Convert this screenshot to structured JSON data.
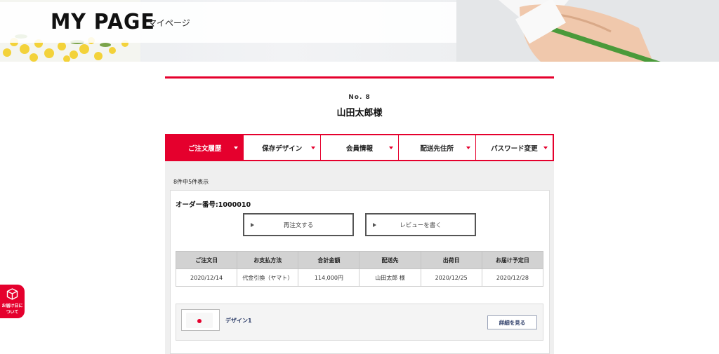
{
  "header": {
    "title": "MY PAGE",
    "subtitle": "マイページ",
    "decor_icons": [
      "yellow-flowers",
      "hand-writing-with-pen"
    ]
  },
  "member": {
    "number": "No. 8",
    "name": "山田太郎様"
  },
  "tabs": [
    {
      "label": "ご注文履歴",
      "active": true
    },
    {
      "label": "保存デザイン",
      "active": false
    },
    {
      "label": "会員情報",
      "active": false
    },
    {
      "label": "配送先住所",
      "active": false
    },
    {
      "label": "パスワード変更",
      "active": false
    }
  ],
  "order_list": {
    "count_text": "8件中5件表示"
  },
  "order": {
    "order_number": "オーダー番号:1000010",
    "reorder_label": "再注文する",
    "review_label": "レビューを書く",
    "columns": [
      "ご注文日",
      "お支払方法",
      "合計金額",
      "配送先",
      "出荷日",
      "お届け予定日"
    ],
    "row": [
      "2020/12/14",
      "代金引換（ヤマト）",
      "114,000円",
      "山田太郎 様",
      "2020/12/25",
      "2020/12/28"
    ],
    "design": {
      "name": "デザイン1",
      "detail_label": "詳細を見る"
    }
  },
  "floating_badge": {
    "line1": "お届け日に",
    "line2": "ついて",
    "icon": "box-icon"
  },
  "colors": {
    "accent": "#e5002d",
    "navy_text": "#2a3a66",
    "panel_bg": "#efefef"
  }
}
